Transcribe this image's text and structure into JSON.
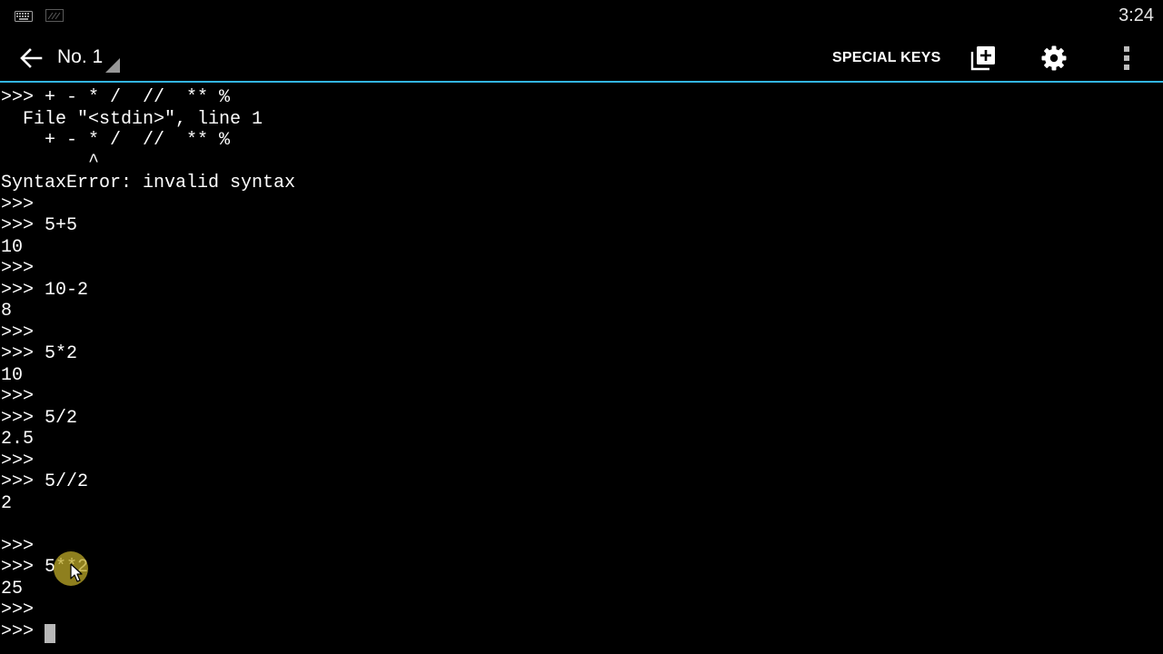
{
  "status_bar": {
    "time": "3:24",
    "icons": [
      "keyboard-icon",
      "screencast-icon"
    ]
  },
  "action_bar": {
    "title": "No. 1",
    "special_keys_label": "SPECIAL KEYS",
    "icons": [
      "back-arrow-icon",
      "new-window-icon",
      "gear-icon",
      "overflow-menu-icon"
    ],
    "accent_color": "#33b5e5"
  },
  "terminal": {
    "lines": [
      ">>> + - * /  //  ** %",
      "  File \"<stdin>\", line 1",
      "    + - * /  //  ** %",
      "        ^",
      "SyntaxError: invalid syntax",
      ">>>",
      ">>> 5+5",
      "10",
      ">>>",
      ">>> 10-2",
      "8",
      ">>>",
      ">>> 5*2",
      "10",
      ">>>",
      ">>> 5/2",
      "2.5",
      ">>>",
      ">>> 5//2",
      "2",
      "",
      ">>>",
      ">>> 5**2",
      "25",
      ">>>",
      ">>> "
    ]
  }
}
